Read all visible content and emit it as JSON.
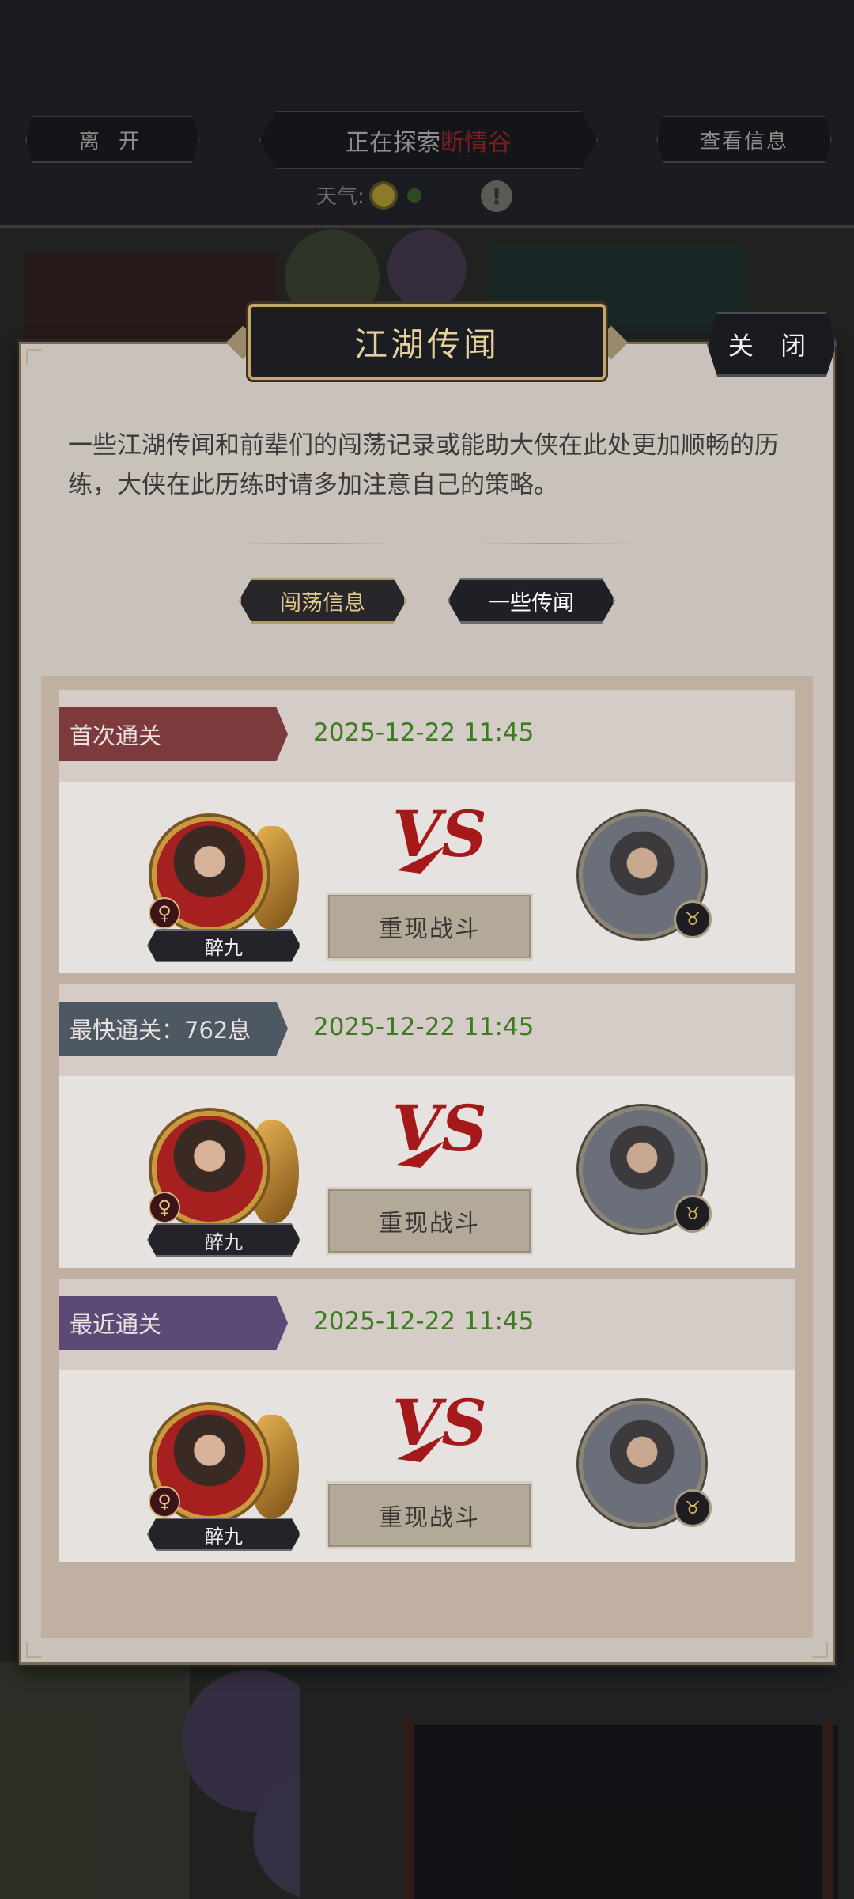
{
  "top_bar": {
    "leave_label": "离 开",
    "explore_prefix": "正在探索",
    "explore_location": "断情谷",
    "info_label": "查看信息",
    "weather_label": "天气:"
  },
  "dialog": {
    "title": "江湖传闻",
    "close_label": "关 闭",
    "description": "一些江湖传闻和前辈们的闯荡记录或能助大侠在此处更加顺畅的历练，大侠在此历练时请多加注意自己的策略。",
    "tabs": [
      "闯荡信息",
      "一些传闻"
    ]
  },
  "records": [
    {
      "label": "首次通关",
      "ribbon_color": "#7d3a3c",
      "date": "2025-12-22 11:45",
      "hero_name": "醉九",
      "gender_symbol": "♀",
      "vs": "VS",
      "replay_label": "重现战斗"
    },
    {
      "label": "最快通关：762息",
      "ribbon_color": "#4d5863",
      "date": "2025-12-22 11:45",
      "hero_name": "醉九",
      "gender_symbol": "♀",
      "vs": "VS",
      "replay_label": "重现战斗"
    },
    {
      "label": "最近通关",
      "ribbon_color": "#5b4a76",
      "date": "2025-12-22 11:45",
      "hero_name": "醉九",
      "gender_symbol": "♀",
      "vs": "VS",
      "replay_label": "重现战斗"
    }
  ],
  "colors": {
    "accent_gold": "#c7a86a",
    "date_green": "#3b7d1f",
    "location_red": "#7a1f1f"
  },
  "icons": {
    "weather": "sun-icon",
    "alert": "exclamation-icon",
    "enemy_badge": "ox-icon"
  }
}
